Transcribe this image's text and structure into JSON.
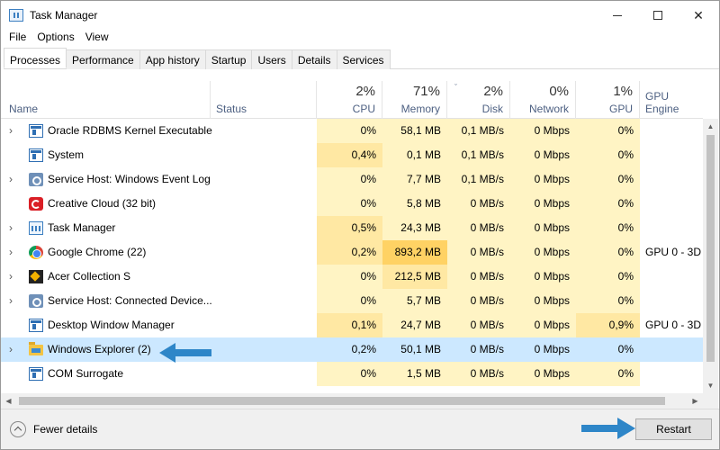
{
  "window": {
    "title": "Task Manager",
    "minimize_glyph": "—",
    "close_glyph": "✕"
  },
  "menu": [
    "File",
    "Options",
    "View"
  ],
  "tabs": [
    "Processes",
    "Performance",
    "App history",
    "Startup",
    "Users",
    "Details",
    "Services"
  ],
  "active_tab": "Processes",
  "columns": {
    "name": "Name",
    "status": "Status",
    "cpu": {
      "percent": "2%",
      "label": "CPU"
    },
    "memory": {
      "percent": "71%",
      "label": "Memory"
    },
    "disk": {
      "percent": "2%",
      "label": "Disk"
    },
    "network": {
      "percent": "0%",
      "label": "Network"
    },
    "gpu": {
      "percent": "1%",
      "label": "GPU"
    },
    "gpu_engine": "GPU Engine"
  },
  "glyphs": {
    "expand": "›",
    "sort": "ˇ",
    "scroll_up": "▲",
    "scroll_down": "▼",
    "scroll_left": "◀",
    "scroll_right": "▶"
  },
  "processes": [
    {
      "name": "Oracle RDBMS Kernel Executable",
      "icon": "app-window-icon",
      "expandable": true,
      "cpu": "0%",
      "memory": "58,1 MB",
      "disk": "0,1 MB/s",
      "network": "0 Mbps",
      "gpu": "0%",
      "gpu_engine": ""
    },
    {
      "name": "System",
      "icon": "app-window-icon",
      "expandable": false,
      "cpu": "0,4%",
      "memory": "0,1 MB",
      "disk": "0,1 MB/s",
      "network": "0 Mbps",
      "gpu": "0%",
      "gpu_engine": ""
    },
    {
      "name": "Service Host: Windows Event Log",
      "icon": "service-gear-icon",
      "expandable": true,
      "cpu": "0%",
      "memory": "7,7 MB",
      "disk": "0,1 MB/s",
      "network": "0 Mbps",
      "gpu": "0%",
      "gpu_engine": ""
    },
    {
      "name": "Creative Cloud (32 bit)",
      "icon": "creative-cloud-icon",
      "expandable": false,
      "cpu": "0%",
      "memory": "5,8 MB",
      "disk": "0 MB/s",
      "network": "0 Mbps",
      "gpu": "0%",
      "gpu_engine": ""
    },
    {
      "name": "Task Manager",
      "icon": "task-manager-icon",
      "expandable": true,
      "cpu": "0,5%",
      "memory": "24,3 MB",
      "disk": "0 MB/s",
      "network": "0 Mbps",
      "gpu": "0%",
      "gpu_engine": ""
    },
    {
      "name": "Google Chrome (22)",
      "icon": "chrome-icon",
      "expandable": true,
      "cpu": "0,2%",
      "memory": "893,2 MB",
      "disk": "0 MB/s",
      "network": "0 Mbps",
      "gpu": "0%",
      "gpu_engine": "GPU 0 - 3D"
    },
    {
      "name": "Acer Collection S",
      "icon": "acer-icon",
      "expandable": true,
      "cpu": "0%",
      "memory": "212,5 MB",
      "disk": "0 MB/s",
      "network": "0 Mbps",
      "gpu": "0%",
      "gpu_engine": ""
    },
    {
      "name": "Service Host: Connected Device...",
      "icon": "service-gear-icon",
      "expandable": true,
      "cpu": "0%",
      "memory": "5,7 MB",
      "disk": "0 MB/s",
      "network": "0 Mbps",
      "gpu": "0%",
      "gpu_engine": ""
    },
    {
      "name": "Desktop Window Manager",
      "icon": "app-window-icon",
      "expandable": false,
      "cpu": "0,1%",
      "memory": "24,7 MB",
      "disk": "0 MB/s",
      "network": "0 Mbps",
      "gpu": "0,9%",
      "gpu_engine": "GPU 0 - 3D"
    },
    {
      "name": "Windows Explorer (2)",
      "icon": "folder-icon",
      "expandable": true,
      "cpu": "0,2%",
      "memory": "50,1 MB",
      "disk": "0 MB/s",
      "network": "0 Mbps",
      "gpu": "0%",
      "gpu_engine": ""
    },
    {
      "name": "COM Surrogate",
      "icon": "app-window-icon",
      "expandable": false,
      "cpu": "0%",
      "memory": "1,5 MB",
      "disk": "0 MB/s",
      "network": "0 Mbps",
      "gpu": "0%",
      "gpu_engine": ""
    }
  ],
  "selected_process": "Windows Explorer (2)",
  "footer": {
    "fewer_details": "Fewer details",
    "restart": "Restart"
  },
  "colors": {
    "heat_light": "#fff4c4",
    "heat_medium": "#ffe8a3",
    "heat_strong": "#ffd264",
    "selection": "#cce8ff",
    "arrow": "#2e86c8"
  }
}
